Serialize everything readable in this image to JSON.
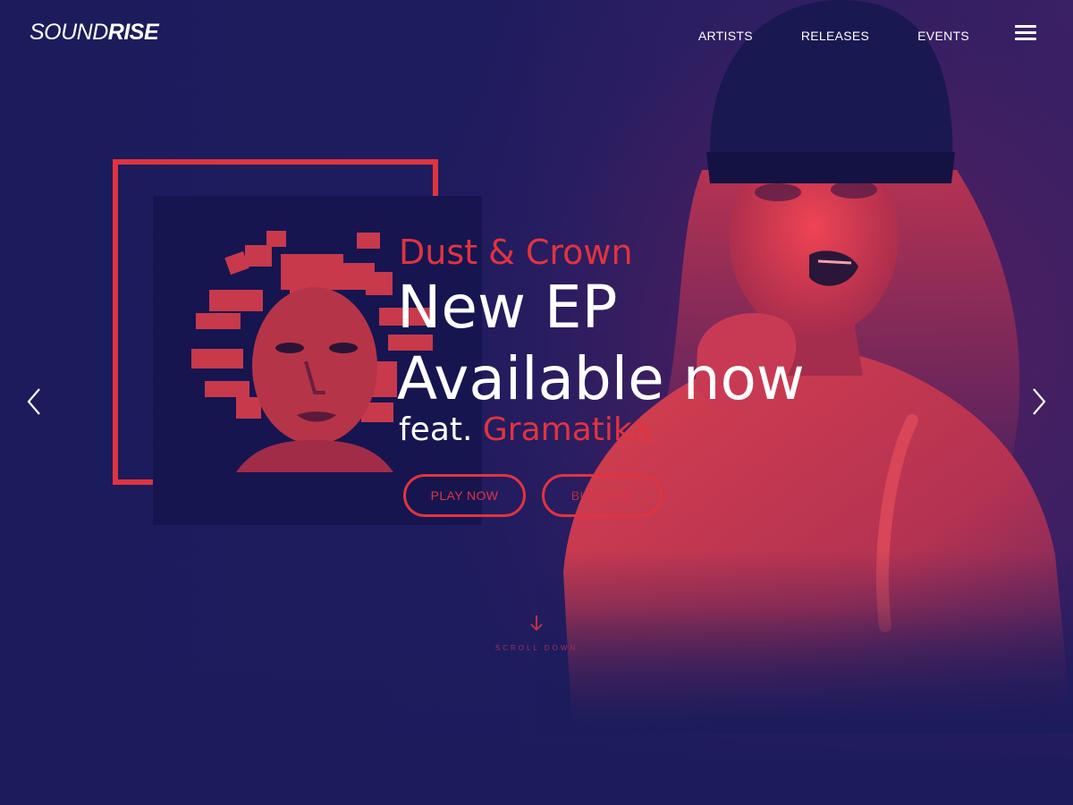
{
  "header": {
    "logo_light": "SOUND",
    "logo_bold": "RISE",
    "nav": [
      "ARTISTS",
      "RELEASES",
      "EVENTS"
    ],
    "menu_icon": "hamburger-menu-icon"
  },
  "hero": {
    "kicker": "Dust & Crown",
    "headline_line1": "New EP",
    "headline_line2": "Available now",
    "feat_prefix": "feat.",
    "feat_artist": "Gramatika",
    "play_button": "PLAY NOW",
    "buy_button": "BUY NOW",
    "prev_icon": "chevron-left-icon",
    "next_icon": "chevron-right-icon"
  },
  "scroll": {
    "label": "SCROLL DOWN",
    "icon": "arrow-down-icon"
  },
  "colors": {
    "background": "#1c1b5c",
    "accent": "#e0343f",
    "text": "#ffffff",
    "panel": "#161550"
  }
}
